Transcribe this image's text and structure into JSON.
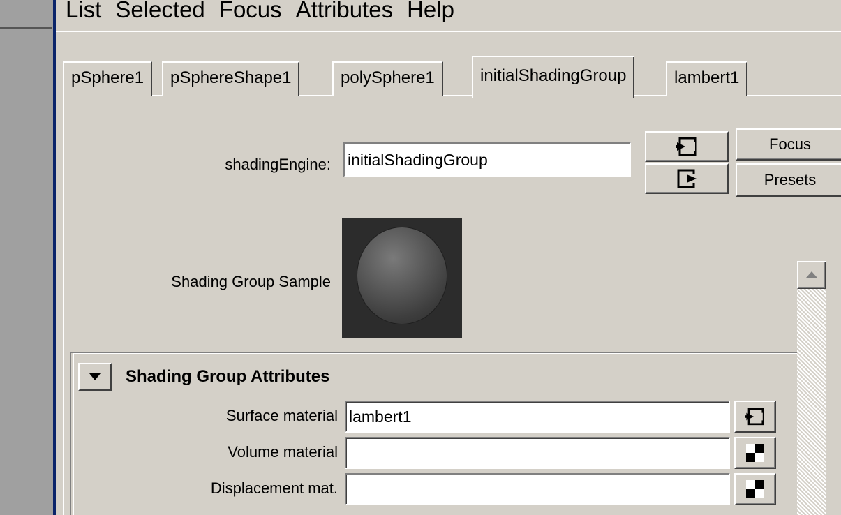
{
  "menu": [
    "List",
    "Selected",
    "Focus",
    "Attributes",
    "Help"
  ],
  "tabs": [
    {
      "label": "pSphere1",
      "active": false
    },
    {
      "label": "pSphereShape1",
      "active": false
    },
    {
      "label": "polySphere1",
      "active": false
    },
    {
      "label": "initialShadingGroup",
      "active": true
    },
    {
      "label": "lambert1",
      "active": false
    }
  ],
  "node": {
    "type_label": "shadingEngine:",
    "name_value": "initialShadingGroup",
    "focus_label": "Focus",
    "presets_label": "Presets",
    "input_connections_icon": "input-connection-icon",
    "output_connections_icon": "output-connection-icon"
  },
  "sample": {
    "label": "Shading Group Sample"
  },
  "section": {
    "title": "Shading Group Attributes",
    "rows": [
      {
        "label": "Surface material",
        "value": "lambert1",
        "icon": "input-connection-icon"
      },
      {
        "label": "Volume material",
        "value": "",
        "icon": "checker-map-icon"
      },
      {
        "label": "Displacement mat.",
        "value": "",
        "icon": "checker-map-icon"
      }
    ]
  },
  "colors": {
    "background": "#d4d0c8",
    "frame_accent": "#0a246a",
    "swatch_bg": "#2c2c2c"
  }
}
